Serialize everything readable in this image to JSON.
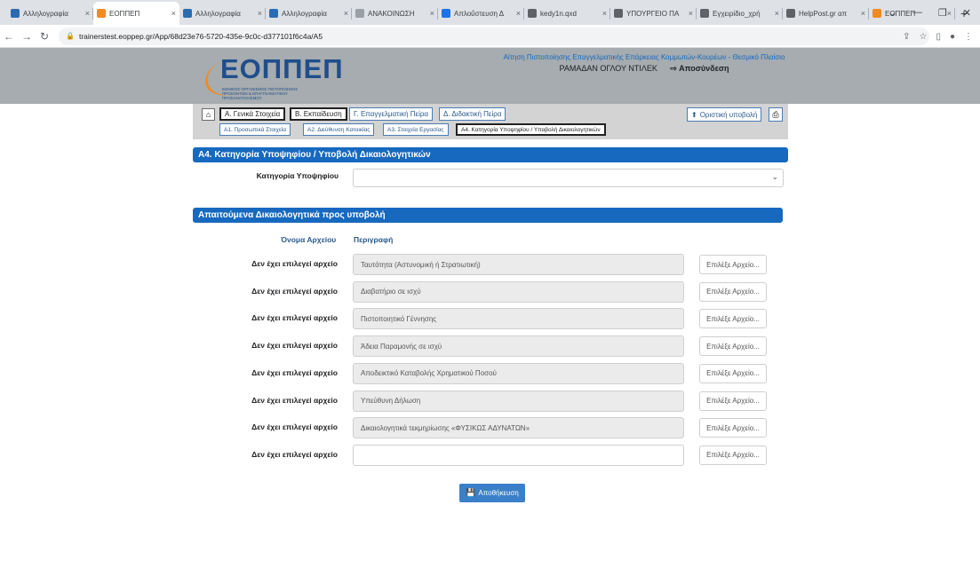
{
  "browser": {
    "tabs": [
      {
        "label": "Αλληλογραφία",
        "favicon_color": "#2b6cb0"
      },
      {
        "label": "ΕΟΠΠΕΠ",
        "favicon_color": "#f08a24"
      },
      {
        "label": "Αλληλογραφία",
        "favicon_color": "#2b6cb0"
      },
      {
        "label": "Αλληλογραφία",
        "favicon_color": "#2b6cb0"
      },
      {
        "label": "ΑΝΑΚΟΙΝΩΣΗ",
        "favicon_color": "#9aa0a6"
      },
      {
        "label": "Απλοΰστευση Δ",
        "favicon_color": "#1a73e8"
      },
      {
        "label": "kedy1n.qxd",
        "favicon_color": "#5f6368"
      },
      {
        "label": "ΥΠΟΥΡΓΕΙΟ ΠΑ",
        "favicon_color": "#5f6368"
      },
      {
        "label": "Εγχειρίδιο_χρή",
        "favicon_color": "#5f6368"
      },
      {
        "label": "HelpPost.gr απ",
        "favicon_color": "#5f6368"
      },
      {
        "label": "ΕΟΠΠΕΠ",
        "favicon_color": "#f08a24"
      }
    ],
    "url": "trainerstest.eoppep.gr/App/68d23e76-5720-435e-9c0c-d377101f6c4a/A5"
  },
  "header": {
    "logo_text": "ΕΟΠΠΕΠ",
    "logo_subtitle": "ΕΘΝΙΚΟΣ ΟΡΓΑΝΙΣΜΟΣ ΠΙΣΤΟΠΟΙΗΣΗΣ ΠΡΟΣΟΝΤΩΝ & ΕΠΑΓΓΕΛΜΑΤΙΚΟΥ ΠΡΟΣΑΝΑΤΟΛΙΣΜΟΥ",
    "title": "Αίτηση Πιστοποίησης Επαγγελματικής Επάρκειας Κομμωτών-Κουρέων - Θεσμικό Πλαίσιο",
    "user": "ΡΑΜΑΔΑΝ ΟΓΛΟΥ ΝΤΙΛΕΚ",
    "logout": "Αποσύνδεση"
  },
  "main_tabs": [
    "Α. Γενικά Στοιχεία",
    "Β. Εκπαίδευση",
    "Γ. Επαγγελματική Πείρα",
    "Δ. Διδακτική Πείρα"
  ],
  "sub_tabs": [
    "Α1. Προσωπικά Στοιχεία",
    "Α2. Διεύθυνση Κατοικίας",
    "Α3. Στοιχεία Εργασίας",
    "Α4. Κατηγορία Υποψηφίου / Υποβολή Δικαιολογητικών"
  ],
  "final_submit": "Οριστική υποβολή",
  "section1": {
    "title": "Α4. Κατηγορία Υποψηφίου / Υποβολή Δικαιολογητικών",
    "category_label": "Κατηγορία Υποψηφίου",
    "category_value": ""
  },
  "section2": {
    "title": "Απαιτούμενα Δικαιολογητικά προς υποβολή",
    "col_filename": "Όνομα Αρχείου",
    "col_description": "Περιγραφή"
  },
  "documents": [
    {
      "file": "Δεν έχει επιλεγεί αρχείο",
      "description": "Ταυτότητα (Αστυνομική ή Στρατιωτική)",
      "button": "Επιλέξε Αρχείο..."
    },
    {
      "file": "Δεν έχει επιλεγεί αρχείο",
      "description": "Διαβατήριο σε ισχύ",
      "button": "Επιλέξε Αρχείο..."
    },
    {
      "file": "Δεν έχει επιλεγεί αρχείο",
      "description": "Πιστοποιητικό Γέννησης",
      "button": "Επιλέξε Αρχείο..."
    },
    {
      "file": "Δεν έχει επιλεγεί αρχείο",
      "description": "Άδεια Παραμονής σε ισχύ",
      "button": "Επιλέξε Αρχείο..."
    },
    {
      "file": "Δεν έχει επιλεγεί αρχείο",
      "description": "Αποδεικτικό Καταβολής Χρηματικού Ποσού",
      "button": "Επιλέξε Αρχείο..."
    },
    {
      "file": "Δεν έχει επιλεγεί αρχείο",
      "description": "Υπεύθυνη Δήλωση",
      "button": "Επιλέξε Αρχείο..."
    },
    {
      "file": "Δεν έχει επιλεγεί αρχείο",
      "description": "Δικαιολογητικά τεκμηρίωσης «ΦΥΣΙΚΩΣ ΑΔΥΝΑΤΩΝ»",
      "button": "Επιλέξε Αρχείο..."
    },
    {
      "file": "Δεν έχει επιλεγεί αρχείο",
      "description": "",
      "button": "Επιλέξε Αρχείο..."
    }
  ],
  "save_button": "Αποθήκευση"
}
